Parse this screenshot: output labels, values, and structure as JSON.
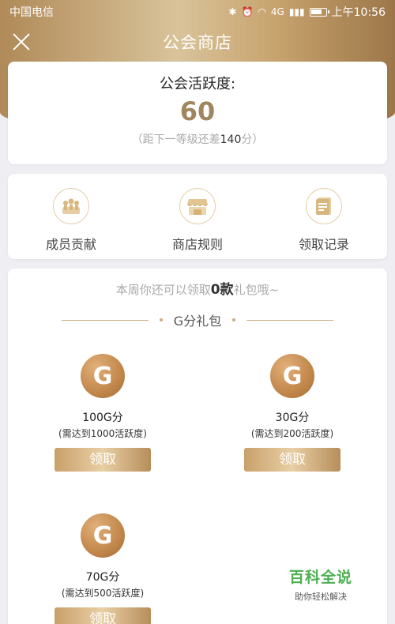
{
  "status_bar": {
    "carrier": "中国电信",
    "time": "上午10:56",
    "net": "4G"
  },
  "nav": {
    "title": "公会商店"
  },
  "activity": {
    "label": "公会活跃度:",
    "value": "60",
    "hint_prefix": "（距下一等级还差",
    "hint_value": "140",
    "hint_suffix": "分）"
  },
  "actions": [
    {
      "label": "成员贡献",
      "icon": "members-icon"
    },
    {
      "label": "商店规则",
      "icon": "store-icon"
    },
    {
      "label": "领取记录",
      "icon": "records-icon"
    }
  ],
  "gifts_section": {
    "weekly_prefix": "本周你还可以领取",
    "weekly_count": "0款",
    "weekly_suffix": "礼包哦~",
    "section_title": "G分礼包",
    "items": [
      {
        "badge": "G",
        "name": "100G分",
        "requirement": "(需达到1000活跃度)",
        "button": "领取"
      },
      {
        "badge": "G",
        "name": "30G分",
        "requirement": "(需达到200活跃度)",
        "button": "领取"
      },
      {
        "badge": "G",
        "name": "70G分",
        "requirement": "(需达到500活跃度)",
        "button": "领取"
      }
    ]
  },
  "watermark": {
    "title": "百科全说",
    "subtitle": "助你轻松解决"
  }
}
